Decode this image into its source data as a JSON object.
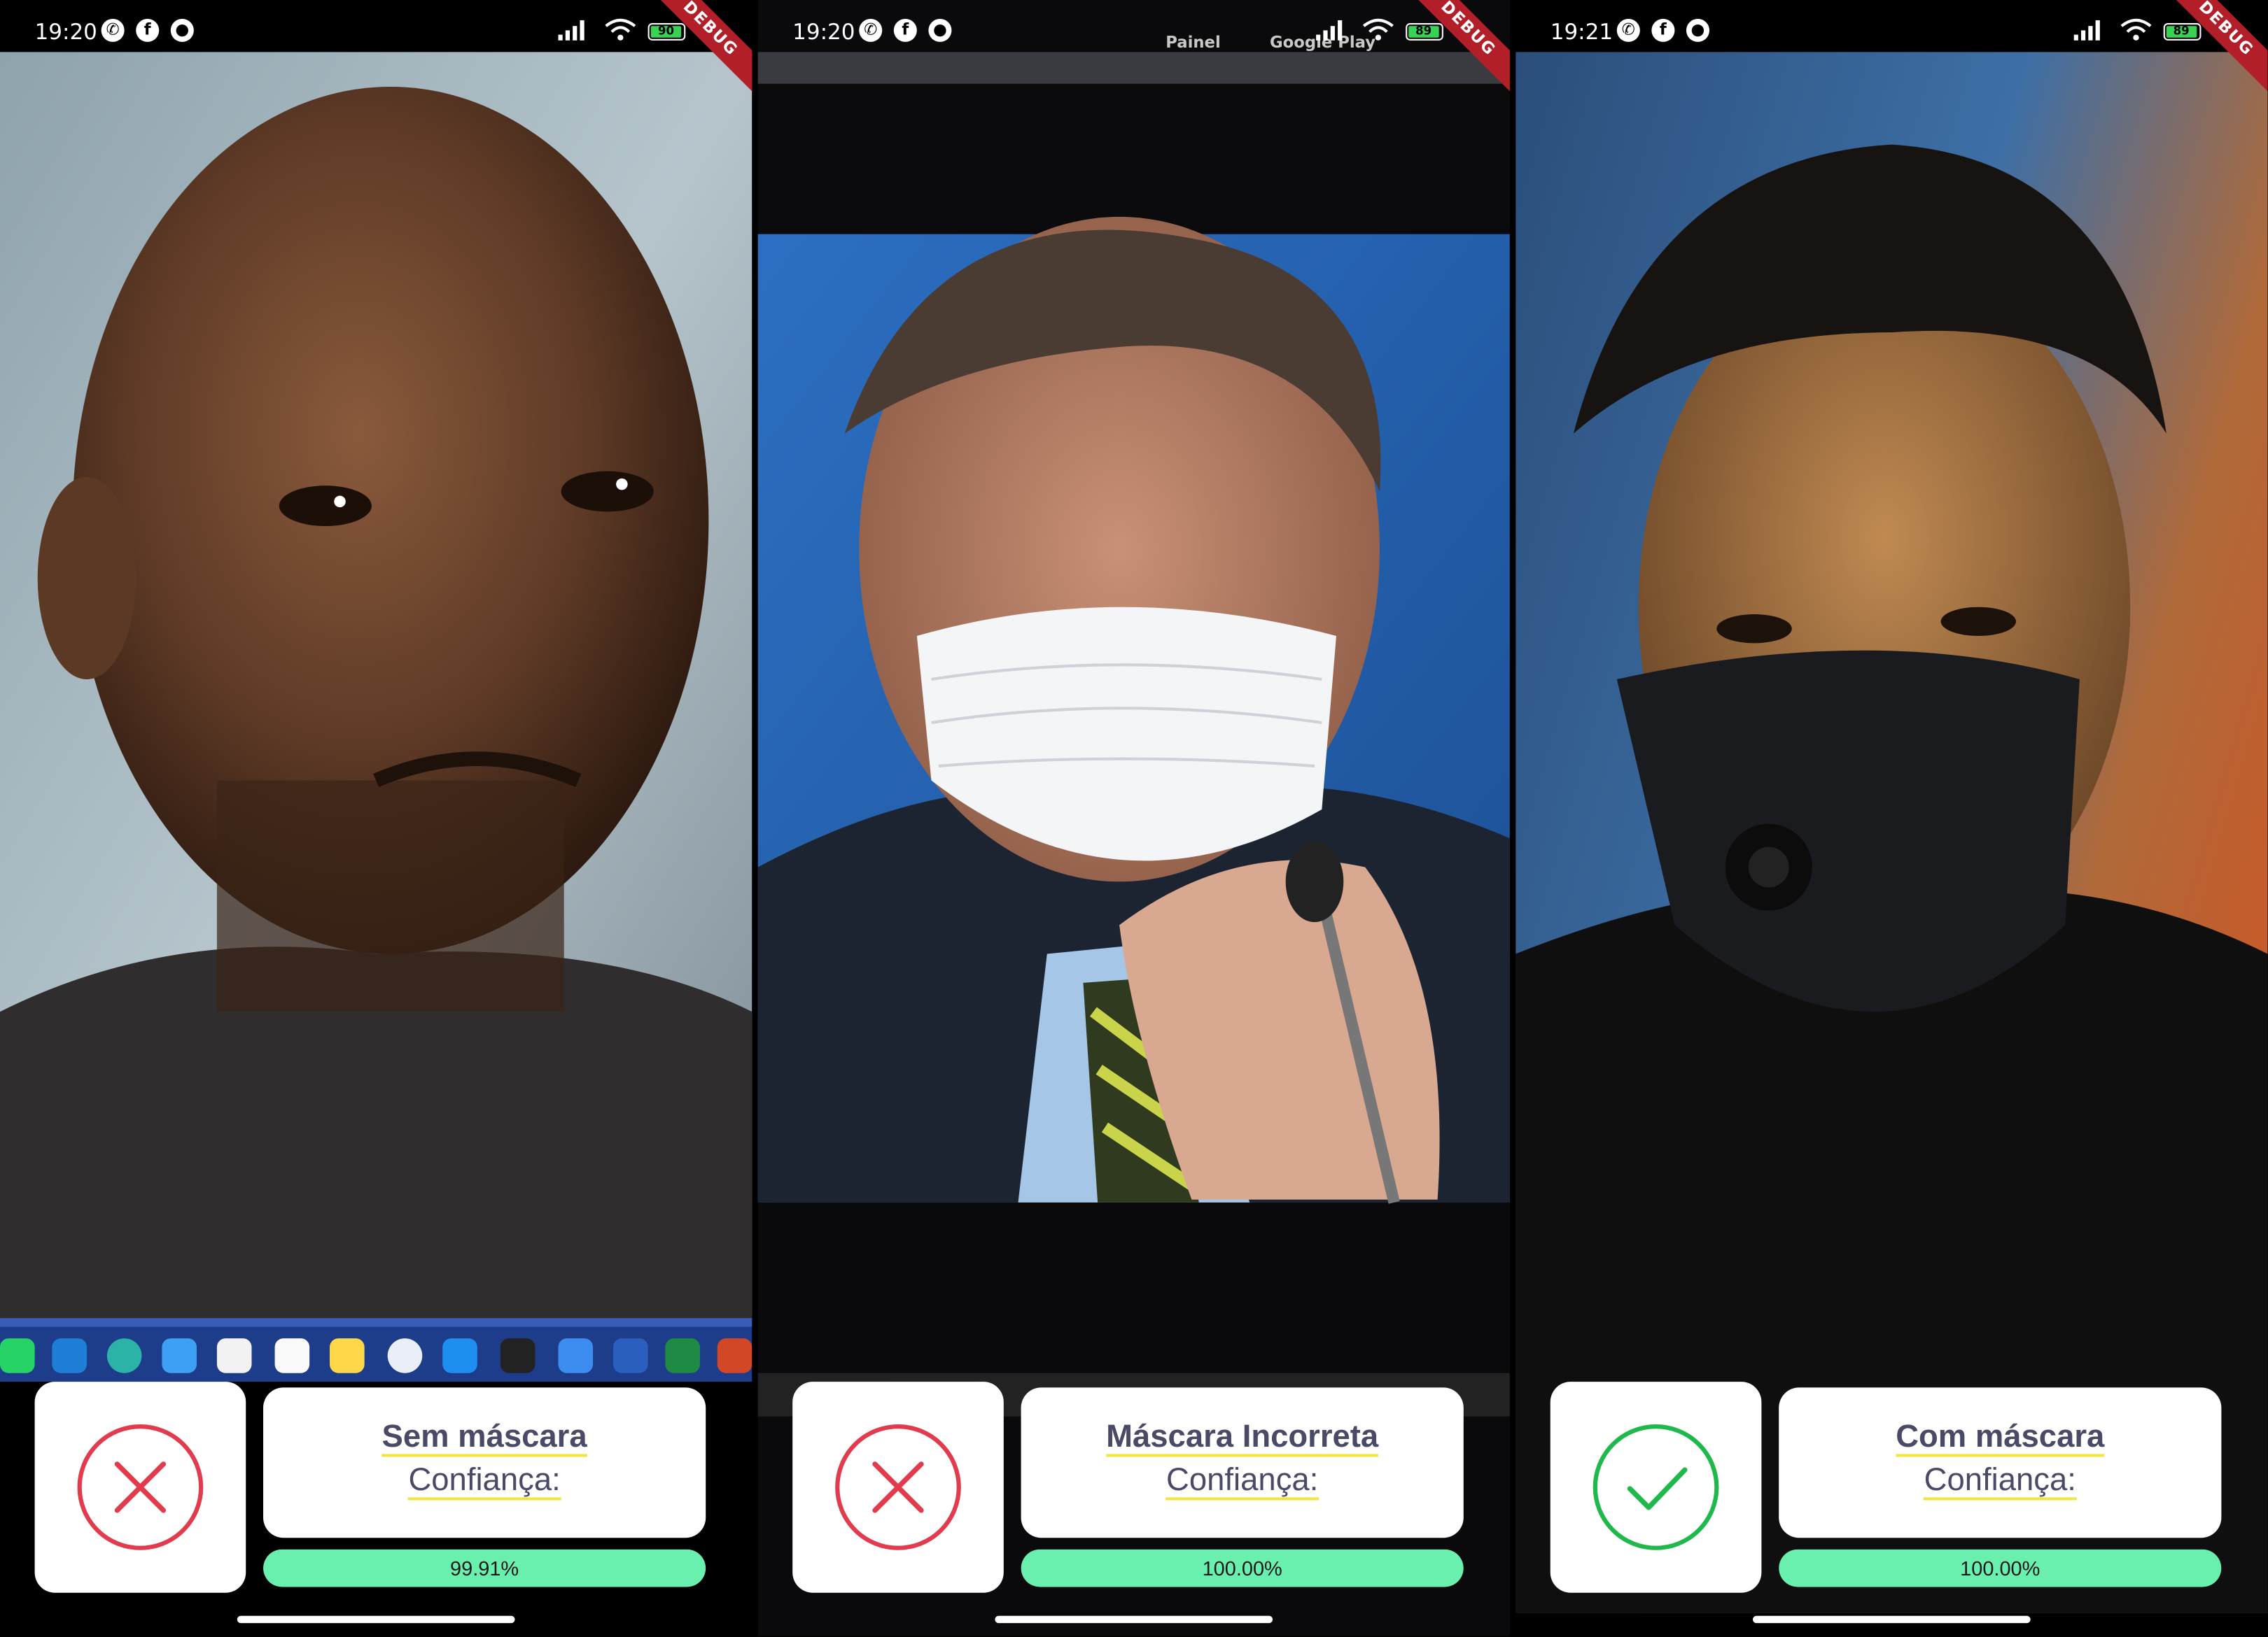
{
  "panels": [
    {
      "status_time": "19:20",
      "battery": "90",
      "debug_label": "DEBUG",
      "result_label": "Sem máscara",
      "confidence_label": "Confiança:",
      "confidence_text": "99.91%",
      "confidence_fraction": 0.9991,
      "status_icon": "x-circle-icon",
      "status_color": "#e23b4e",
      "dock_apps": [
        "WhatsApp",
        "VS Code",
        "Edge",
        "Mail",
        "Calendar",
        "Reminders",
        "Notes",
        "Arc",
        "App Store",
        "Terminal",
        "Xcode",
        "Word",
        "Excel",
        "PowerPoint"
      ]
    },
    {
      "status_time": "19:20",
      "battery": "89",
      "debug_label": "DEBUG",
      "result_label": "Máscara Incorreta",
      "confidence_label": "Confiança:",
      "confidence_text": "100.00%",
      "confidence_fraction": 1.0,
      "status_icon": "x-circle-icon",
      "status_color": "#e23b4e",
      "browser_bookmarks": [
        "Painel",
        "Google Play"
      ]
    },
    {
      "status_time": "19:21",
      "battery": "89",
      "debug_label": "DEBUG",
      "result_label": "Com máscara",
      "confidence_label": "Confiança:",
      "confidence_text": "100.00%",
      "confidence_fraction": 1.0,
      "status_icon": "check-circle-icon",
      "status_color": "#1fb84a"
    }
  ],
  "colors": {
    "card_bg": "#ffffff",
    "label_text": "#4b4a66",
    "underline": "#f2e53d",
    "bar_fill": "#69f0ae",
    "debug_banner": "#b21f28"
  }
}
